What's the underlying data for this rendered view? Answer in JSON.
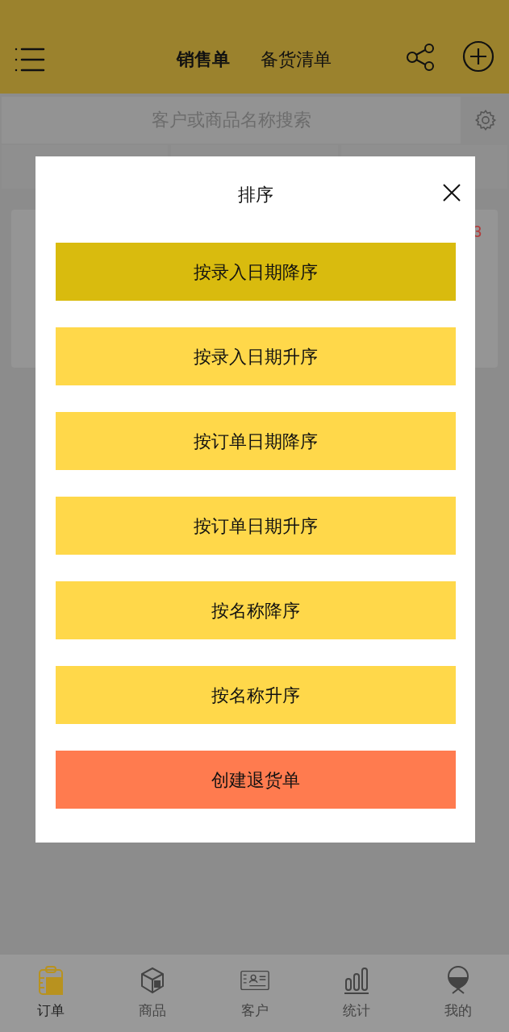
{
  "header": {
    "tabs": [
      {
        "label": "销售单",
        "selected": true
      },
      {
        "label": "备货清单",
        "selected": false
      }
    ]
  },
  "search": {
    "placeholder": "客户或商品名称搜索"
  },
  "order_card": {
    "badge": "3"
  },
  "dialog": {
    "title": "排序",
    "options": [
      {
        "label": "按录入日期降序",
        "kind": "sort",
        "selected": true
      },
      {
        "label": "按录入日期升序",
        "kind": "sort",
        "selected": false
      },
      {
        "label": "按订单日期降序",
        "kind": "sort",
        "selected": false
      },
      {
        "label": "按订单日期升序",
        "kind": "sort",
        "selected": false
      },
      {
        "label": "按名称降序",
        "kind": "sort",
        "selected": false
      },
      {
        "label": "按名称升序",
        "kind": "sort",
        "selected": false
      },
      {
        "label": "创建退货单",
        "kind": "action",
        "selected": false
      }
    ]
  },
  "bottom_nav": [
    {
      "label": "订单",
      "selected": true
    },
    {
      "label": "商品",
      "selected": false
    },
    {
      "label": "客户",
      "selected": false
    },
    {
      "label": "统计",
      "selected": false
    },
    {
      "label": "我的",
      "selected": false
    }
  ]
}
